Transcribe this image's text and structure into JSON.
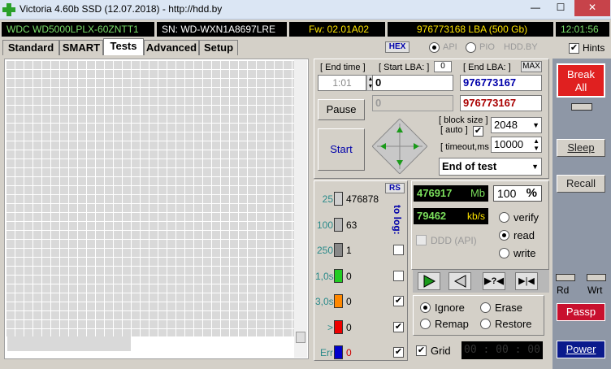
{
  "window": {
    "title": "Victoria 4.60b SSD (12.07.2018) - http://hdd.by",
    "min": "—",
    "max": "☐",
    "close": "✕"
  },
  "info": {
    "model": "WDC WD5000LPLX-60ZNTT1",
    "serial": "SN: WD-WXN1A8697LRE",
    "firmware": "Fw: 02.01A02",
    "lba": "976773168 LBA (500 Gb)",
    "time": "12:01:56"
  },
  "tabs": [
    "Standard",
    "SMART",
    "Tests",
    "Advanced",
    "Setup"
  ],
  "hex": "HEX",
  "modes": {
    "api": "API",
    "pio": "PIO",
    "hddby": "HDD.BY"
  },
  "hints": "Hints",
  "test": {
    "end_time_label": "[ End time ]",
    "end_time_value": "1:01",
    "start_lba_label": "[ Start LBA: ]",
    "start_lba_small": "0",
    "end_lba_label": "[ End LBA: ]",
    "max_label": "MAX",
    "start_lba": "0",
    "end_lba": "976773167",
    "cur_lba": "0",
    "cur_end_lba": "976773167",
    "pause": "Pause",
    "start": "Start",
    "block_size_label": "[ block size ]",
    "auto_label": "[ auto ]",
    "block_size": "2048",
    "timeout_label": "[ timeout,ms ]",
    "timeout": "10000",
    "end_mode": "End of test"
  },
  "stats": {
    "rs": "RS",
    "to_log": "to log:",
    "rows": [
      {
        "label": "25",
        "value": "476878",
        "color": "#d0d0d0"
      },
      {
        "label": "100",
        "value": "63",
        "color": "#b8b8b8"
      },
      {
        "label": "250",
        "value": "1",
        "color": "#888888"
      },
      {
        "label": "1,0s",
        "value": "0",
        "color": "#22cc22"
      },
      {
        "label": "3,0s",
        "value": "0",
        "color": "#ff8800"
      },
      {
        "label": ">",
        "value": "0",
        "color": "#ee0000"
      },
      {
        "label": "Err",
        "value": "0",
        "color": "#0000cc"
      }
    ]
  },
  "progress": {
    "mb": "476917",
    "mb_unit": "Mb",
    "percent": "100",
    "percent_sign": "%",
    "speed": "79462",
    "speed_unit": "kb/s",
    "ddd": "DDD (API)",
    "verify": "verify",
    "read": "read",
    "write": "write"
  },
  "actions": {
    "ignore": "Ignore",
    "erase": "Erase",
    "remap": "Remap",
    "restore": "Restore",
    "grid": "Grid",
    "timer": "00 : 00 : 00"
  },
  "side": {
    "break": "Break\nAll",
    "sleep": "Sleep",
    "recall": "Recall",
    "rd": "Rd",
    "wrt": "Wrt",
    "passp": "Passp",
    "power": "Power"
  },
  "colors": {
    "accent_red": "#e02020",
    "green": "#7bdf5c",
    "yellow": "#ffe600"
  }
}
